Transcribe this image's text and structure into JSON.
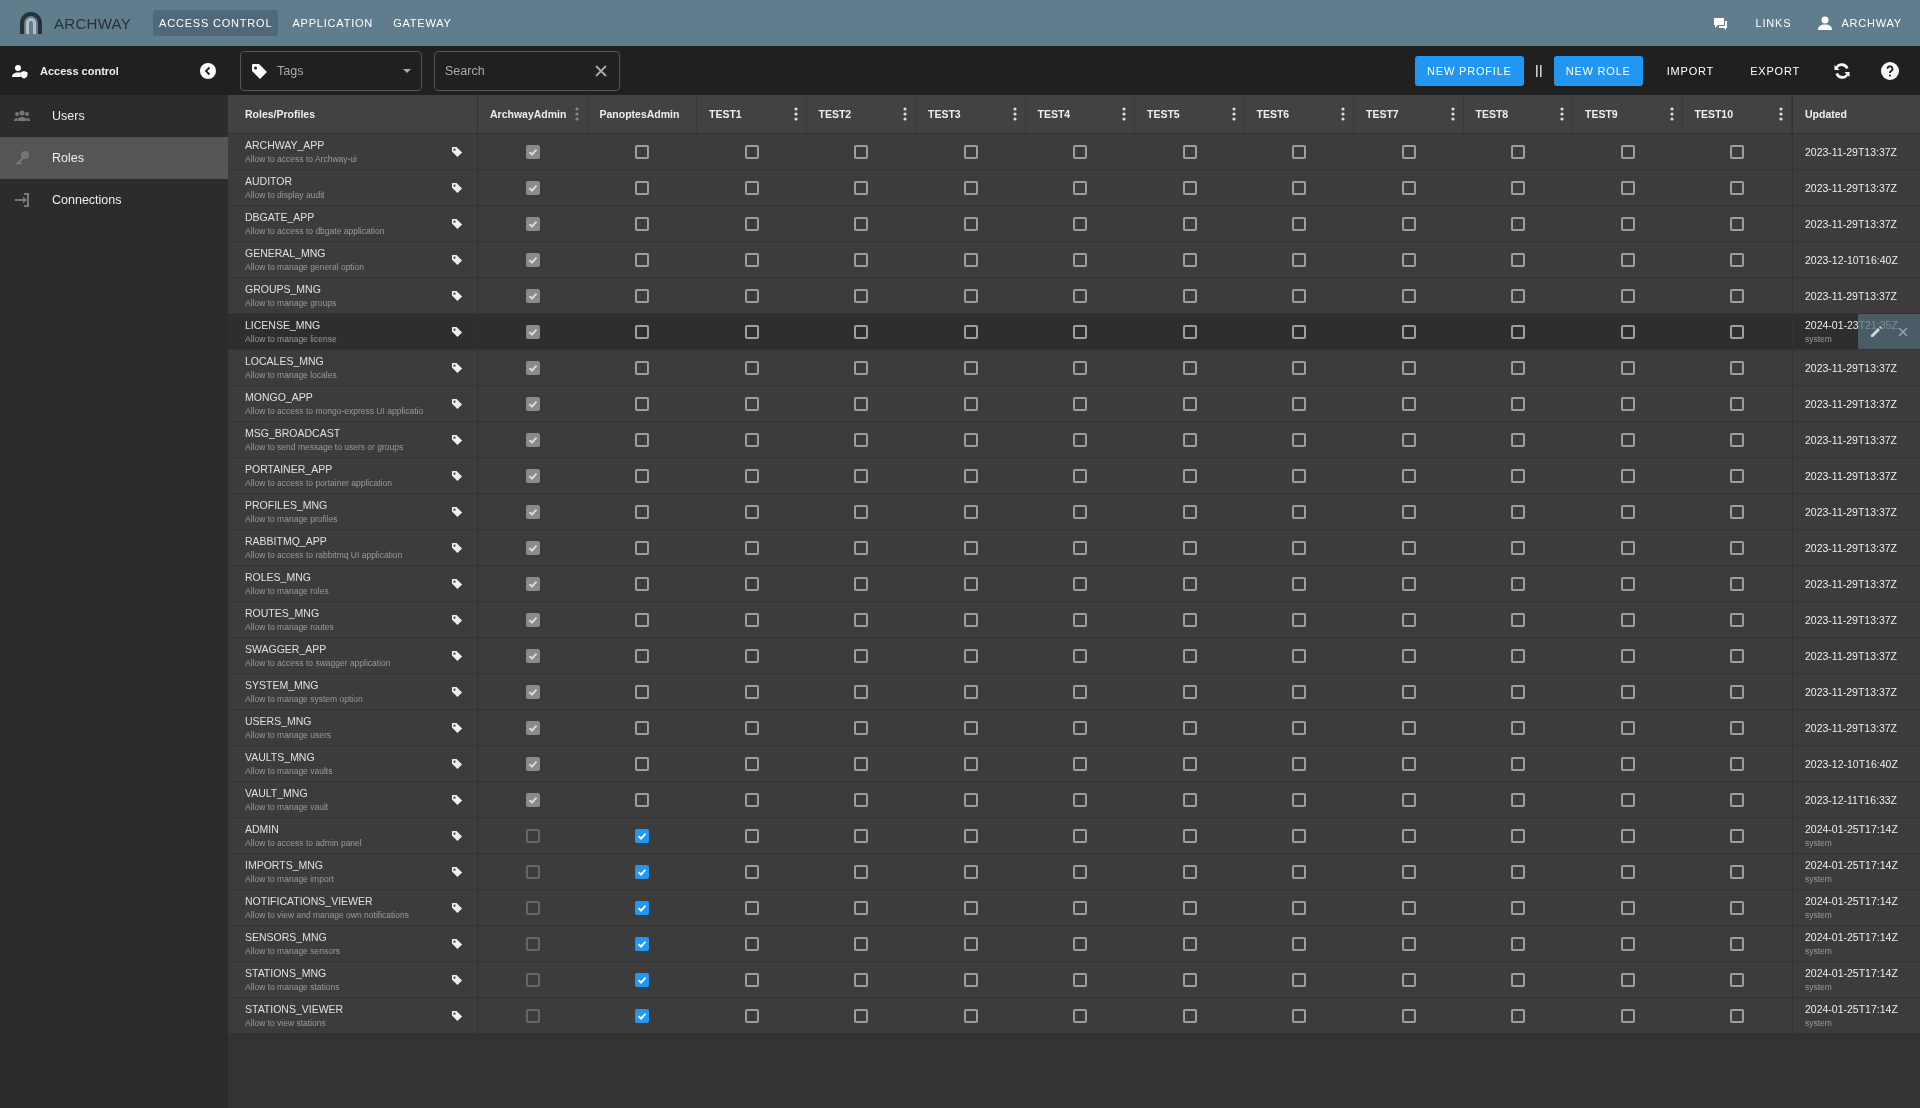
{
  "header": {
    "brand": "ARCHWAY",
    "nav": [
      {
        "label": "ACCESS CONTROL",
        "selected": true
      },
      {
        "label": "APPLICATION",
        "selected": false
      },
      {
        "label": "GATEWAY",
        "selected": false
      }
    ],
    "links": "LINKS",
    "user": "ARCHWAY"
  },
  "sidebar": {
    "title": "Access control",
    "items": [
      {
        "label": "Users",
        "selected": false
      },
      {
        "label": "Roles",
        "selected": true
      },
      {
        "label": "Connections",
        "selected": false
      }
    ]
  },
  "toolbar": {
    "tags": {
      "placeholder": "Tags"
    },
    "search": {
      "placeholder": "Search"
    },
    "buttons": [
      {
        "label": "NEW PROFILE",
        "kind": "primary"
      },
      {
        "label": "NEW ROLE",
        "kind": "primary"
      },
      {
        "label": "IMPORT",
        "kind": "text"
      },
      {
        "label": "EXPORT",
        "kind": "text"
      }
    ]
  },
  "table": {
    "first_column": "Roles/Profiles",
    "last_column": "Updated",
    "profiles": [
      {
        "name": "ArchwayAdmin",
        "disabled": true,
        "menu": true
      },
      {
        "name": "PanoptesAdmin",
        "disabled": false,
        "menu": false
      },
      {
        "name": "TEST1",
        "disabled": false,
        "menu": true
      },
      {
        "name": "TEST2",
        "disabled": false,
        "menu": true
      },
      {
        "name": "TEST3",
        "disabled": false,
        "menu": true
      },
      {
        "name": "TEST4",
        "disabled": false,
        "menu": true
      },
      {
        "name": "TEST5",
        "disabled": false,
        "menu": true
      },
      {
        "name": "TEST6",
        "disabled": false,
        "menu": true
      },
      {
        "name": "TEST7",
        "disabled": false,
        "menu": true
      },
      {
        "name": "TEST8",
        "disabled": false,
        "menu": true
      },
      {
        "name": "TEST9",
        "disabled": false,
        "menu": true
      },
      {
        "name": "TEST10",
        "disabled": false,
        "menu": true
      }
    ],
    "rows": [
      {
        "name": "ARCHWAY_APP",
        "description": "Allow to access to Archway-ui",
        "updated": "2023-11-29T13:37Z",
        "hovered": false,
        "grants": [
          true,
          false,
          false,
          false,
          false,
          false,
          false,
          false,
          false,
          false,
          false,
          false
        ]
      },
      {
        "name": "AUDITOR",
        "description": "Allow to display audit",
        "updated": "2023-11-29T13:37Z",
        "hovered": false,
        "grants": [
          true,
          false,
          false,
          false,
          false,
          false,
          false,
          false,
          false,
          false,
          false,
          false
        ]
      },
      {
        "name": "DBGATE_APP",
        "description": "Allow to access to dbgate application",
        "updated": "2023-11-29T13:37Z",
        "hovered": false,
        "grants": [
          true,
          false,
          false,
          false,
          false,
          false,
          false,
          false,
          false,
          false,
          false,
          false
        ]
      },
      {
        "name": "GENERAL_MNG",
        "description": "Allow to manage general option",
        "updated": "2023-12-10T16:40Z",
        "hovered": false,
        "grants": [
          true,
          false,
          false,
          false,
          false,
          false,
          false,
          false,
          false,
          false,
          false,
          false
        ]
      },
      {
        "name": "GROUPS_MNG",
        "description": "Allow to manage groups",
        "updated": "2023-11-29T13:37Z",
        "hovered": false,
        "grants": [
          true,
          false,
          false,
          false,
          false,
          false,
          false,
          false,
          false,
          false,
          false,
          false
        ]
      },
      {
        "name": "LICENSE_MNG",
        "description": "Allow to manage license",
        "updated": "2024-01-23T21:35Z",
        "updated_by": "system",
        "hovered": true,
        "grants": [
          true,
          false,
          false,
          false,
          false,
          false,
          false,
          false,
          false,
          false,
          false,
          false
        ]
      },
      {
        "name": "LOCALES_MNG",
        "description": "Allow to manage locales",
        "updated": "2023-11-29T13:37Z",
        "hovered": false,
        "grants": [
          true,
          false,
          false,
          false,
          false,
          false,
          false,
          false,
          false,
          false,
          false,
          false
        ]
      },
      {
        "name": "MONGO_APP",
        "description": "Allow to access to mongo-express UI applicatio",
        "updated": "2023-11-29T13:37Z",
        "hovered": false,
        "grants": [
          true,
          false,
          false,
          false,
          false,
          false,
          false,
          false,
          false,
          false,
          false,
          false
        ]
      },
      {
        "name": "MSG_BROADCAST",
        "description": "Allow to send message to users or groups",
        "updated": "2023-11-29T13:37Z",
        "hovered": false,
        "grants": [
          true,
          false,
          false,
          false,
          false,
          false,
          false,
          false,
          false,
          false,
          false,
          false
        ]
      },
      {
        "name": "PORTAINER_APP",
        "description": "Allow to access to portainer application",
        "updated": "2023-11-29T13:37Z",
        "hovered": false,
        "grants": [
          true,
          false,
          false,
          false,
          false,
          false,
          false,
          false,
          false,
          false,
          false,
          false
        ]
      },
      {
        "name": "PROFILES_MNG",
        "description": "Allow to manage profiles",
        "updated": "2023-11-29T13:37Z",
        "hovered": false,
        "grants": [
          true,
          false,
          false,
          false,
          false,
          false,
          false,
          false,
          false,
          false,
          false,
          false
        ]
      },
      {
        "name": "RABBITMQ_APP",
        "description": "Allow to access to rabbitmq UI application",
        "updated": "2023-11-29T13:37Z",
        "hovered": false,
        "grants": [
          true,
          false,
          false,
          false,
          false,
          false,
          false,
          false,
          false,
          false,
          false,
          false
        ]
      },
      {
        "name": "ROLES_MNG",
        "description": "Allow to manage roles",
        "updated": "2023-11-29T13:37Z",
        "hovered": false,
        "grants": [
          true,
          false,
          false,
          false,
          false,
          false,
          false,
          false,
          false,
          false,
          false,
          false
        ]
      },
      {
        "name": "ROUTES_MNG",
        "description": "Allow to manage routes",
        "updated": "2023-11-29T13:37Z",
        "hovered": false,
        "grants": [
          true,
          false,
          false,
          false,
          false,
          false,
          false,
          false,
          false,
          false,
          false,
          false
        ]
      },
      {
        "name": "SWAGGER_APP",
        "description": "Allow to access to swagger application",
        "updated": "2023-11-29T13:37Z",
        "hovered": false,
        "grants": [
          true,
          false,
          false,
          false,
          false,
          false,
          false,
          false,
          false,
          false,
          false,
          false
        ]
      },
      {
        "name": "SYSTEM_MNG",
        "description": "Allow to manage system option",
        "updated": "2023-11-29T13:37Z",
        "hovered": false,
        "grants": [
          true,
          false,
          false,
          false,
          false,
          false,
          false,
          false,
          false,
          false,
          false,
          false
        ]
      },
      {
        "name": "USERS_MNG",
        "description": "Allow to manage users",
        "updated": "2023-11-29T13:37Z",
        "hovered": false,
        "grants": [
          true,
          false,
          false,
          false,
          false,
          false,
          false,
          false,
          false,
          false,
          false,
          false
        ]
      },
      {
        "name": "VAULTS_MNG",
        "description": "Allow to manage vaults",
        "updated": "2023-12-10T16:40Z",
        "hovered": false,
        "grants": [
          true,
          false,
          false,
          false,
          false,
          false,
          false,
          false,
          false,
          false,
          false,
          false
        ]
      },
      {
        "name": "VAULT_MNG",
        "description": "Allow to manage vault",
        "updated": "2023-12-11T16:33Z",
        "hovered": false,
        "grants": [
          true,
          false,
          false,
          false,
          false,
          false,
          false,
          false,
          false,
          false,
          false,
          false
        ]
      },
      {
        "name": "ADMIN",
        "description": "Allow to access to admin panel",
        "updated": "2024-01-25T17:14Z",
        "updated_by": "system",
        "hovered": false,
        "grants": [
          false,
          true,
          false,
          false,
          false,
          false,
          false,
          false,
          false,
          false,
          false,
          false
        ]
      },
      {
        "name": "IMPORTS_MNG",
        "description": "Allow to manage import",
        "updated": "2024-01-25T17:14Z",
        "updated_by": "system",
        "hovered": false,
        "grants": [
          false,
          true,
          false,
          false,
          false,
          false,
          false,
          false,
          false,
          false,
          false,
          false
        ]
      },
      {
        "name": "NOTIFICATIONS_VIEWER",
        "description": "Allow to view and manage own notifications",
        "updated": "2024-01-25T17:14Z",
        "updated_by": "system",
        "hovered": false,
        "grants": [
          false,
          true,
          false,
          false,
          false,
          false,
          false,
          false,
          false,
          false,
          false,
          false
        ]
      },
      {
        "name": "SENSORS_MNG",
        "description": "Allow to manage sensors",
        "updated": "2024-01-25T17:14Z",
        "updated_by": "system",
        "hovered": false,
        "grants": [
          false,
          true,
          false,
          false,
          false,
          false,
          false,
          false,
          false,
          false,
          false,
          false
        ]
      },
      {
        "name": "STATIONS_MNG",
        "description": "Allow to manage stations",
        "updated": "2024-01-25T17:14Z",
        "updated_by": "system",
        "hovered": false,
        "grants": [
          false,
          true,
          false,
          false,
          false,
          false,
          false,
          false,
          false,
          false,
          false,
          false
        ]
      },
      {
        "name": "STATIONS_VIEWER",
        "description": "Allow to view stations",
        "updated": "2024-01-25T17:14Z",
        "updated_by": "system",
        "hovered": false,
        "grants": [
          false,
          true,
          false,
          false,
          false,
          false,
          false,
          false,
          false,
          false,
          false,
          false
        ]
      }
    ]
  }
}
